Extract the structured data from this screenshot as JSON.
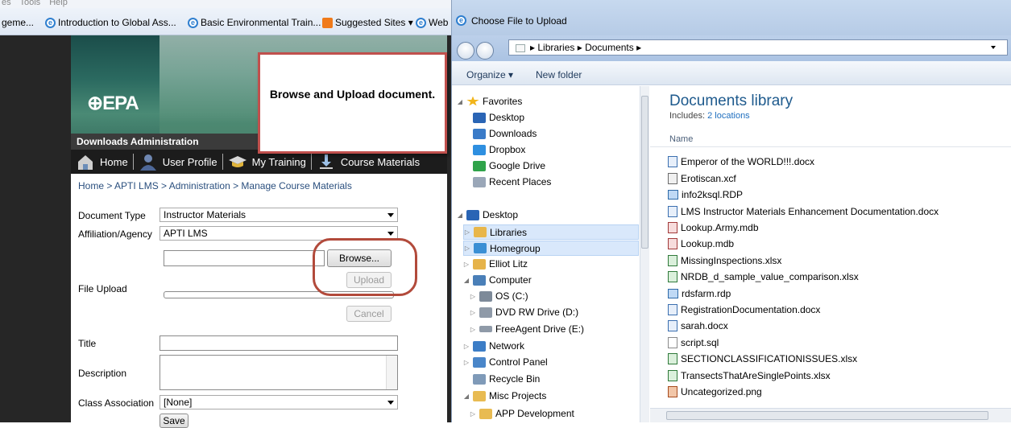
{
  "ie": {
    "menu": [
      "es",
      "Tools",
      "Help"
    ],
    "favorites": [
      {
        "label": "geme...",
        "icon": "ie-icon"
      },
      {
        "label": "Introduction to Global Ass...",
        "icon": "ie-icon"
      },
      {
        "label": "Basic Environmental Train...",
        "icon": "ie-icon"
      },
      {
        "label": "Suggested Sites ▾",
        "icon": "suggested-sites-icon"
      },
      {
        "label": "Web",
        "icon": "ie-icon"
      }
    ]
  },
  "epa": {
    "logo": "⊕EPA",
    "admin_title": "Downloads Administration",
    "nav": [
      "Home",
      "User Profile",
      "My Training",
      "Course Materials"
    ],
    "breadcrumb": "Home > APTI LMS > Administration > Manage Course Materials",
    "form": {
      "document_type_label": "Document Type",
      "document_type_value": "Instructor Materials",
      "affiliation_label": "Affiliation/Agency",
      "affiliation_value": "APTI LMS",
      "file_upload_label": "File Upload",
      "browse_label": "Browse...",
      "upload_label": "Upload",
      "cancel_label": "Cancel",
      "title_label": "Title",
      "description_label": "Description",
      "class_association_label": "Class Association",
      "class_association_value": "[None]",
      "save_label": "Save"
    },
    "callout": "Browse and Upload document."
  },
  "dialog": {
    "title": "Choose File to Upload",
    "address": "▸ Libraries ▸ Documents ▸",
    "toolbar": {
      "organize": "Organize ▾",
      "new_folder": "New folder"
    },
    "nav_tree": [
      {
        "label": "Favorites",
        "icon": "star-icon",
        "color": "#f2b51b"
      },
      {
        "label": "Desktop",
        "icon": "desktop-icon",
        "color": "#2a65b5"
      },
      {
        "label": "Downloads",
        "icon": "downloads-icon",
        "color": "#3a7bc8"
      },
      {
        "label": "Dropbox",
        "icon": "dropbox-icon",
        "color": "#2e8fe0"
      },
      {
        "label": "Google Drive",
        "icon": "google-drive-icon",
        "color": "#2fa34a"
      },
      {
        "label": "Recent Places",
        "icon": "recent-places-icon",
        "color": "#9aa7b8"
      },
      {
        "label": "Desktop",
        "icon": "desktop-icon",
        "color": "#2a65b5"
      },
      {
        "label": "Libraries",
        "icon": "libraries-icon",
        "color": "#e8b64a"
      },
      {
        "label": "Homegroup",
        "icon": "homegroup-icon",
        "color": "#3b8fd4"
      },
      {
        "label": "Elliot Litz",
        "icon": "user-folder-icon",
        "color": "#e6b34a"
      },
      {
        "label": "Computer",
        "icon": "computer-icon",
        "color": "#4a7fb8"
      },
      {
        "label": "OS (C:)",
        "icon": "drive-icon",
        "color": "#7d8a99"
      },
      {
        "label": "DVD RW Drive (D:)",
        "icon": "dvd-drive-icon",
        "color": "#8f9aa8"
      },
      {
        "label": "FreeAgent Drive (E:)",
        "icon": "drive-icon",
        "color": "#8f9aa8"
      },
      {
        "label": "Network",
        "icon": "network-icon",
        "color": "#3c7dc6"
      },
      {
        "label": "Control Panel",
        "icon": "control-panel-icon",
        "color": "#4a86c9"
      },
      {
        "label": "Recycle Bin",
        "icon": "recycle-bin-icon",
        "color": "#7f9ab8"
      },
      {
        "label": "Misc Projects",
        "icon": "folder-icon",
        "color": "#e8bb52"
      },
      {
        "label": "APP Development",
        "icon": "folder-icon",
        "color": "#e8bb52"
      }
    ],
    "library_title": "Documents library",
    "library_includes": "Includes:",
    "library_locations": "2 locations",
    "column_name": "Name",
    "files": [
      {
        "name": "Emperor of the WORLD!!!.docx",
        "type": "doc"
      },
      {
        "name": "Erotiscan.xcf",
        "type": "xcf"
      },
      {
        "name": "info2ksql.RDP",
        "type": "rdp"
      },
      {
        "name": "LMS Instructor Materials Enhancement Documentation.docx",
        "type": "doc"
      },
      {
        "name": "Lookup.Army.mdb",
        "type": "acc"
      },
      {
        "name": "Lookup.mdb",
        "type": "acc"
      },
      {
        "name": "MissingInspections.xlsx",
        "type": "xl"
      },
      {
        "name": "NRDB_d_sample_value_comparison.xlsx",
        "type": "xl"
      },
      {
        "name": "rdsfarm.rdp",
        "type": "rdp"
      },
      {
        "name": "RegistrationDocumentation.docx",
        "type": "doc"
      },
      {
        "name": "sarah.docx",
        "type": "doc"
      },
      {
        "name": "script.sql",
        "type": "sql"
      },
      {
        "name": "SECTIONCLASSIFICATIONISSUES.xlsx",
        "type": "xl"
      },
      {
        "name": "TransectsThatAreSinglePoints.xlsx",
        "type": "xl"
      },
      {
        "name": "Uncategorized.png",
        "type": "png"
      }
    ]
  }
}
